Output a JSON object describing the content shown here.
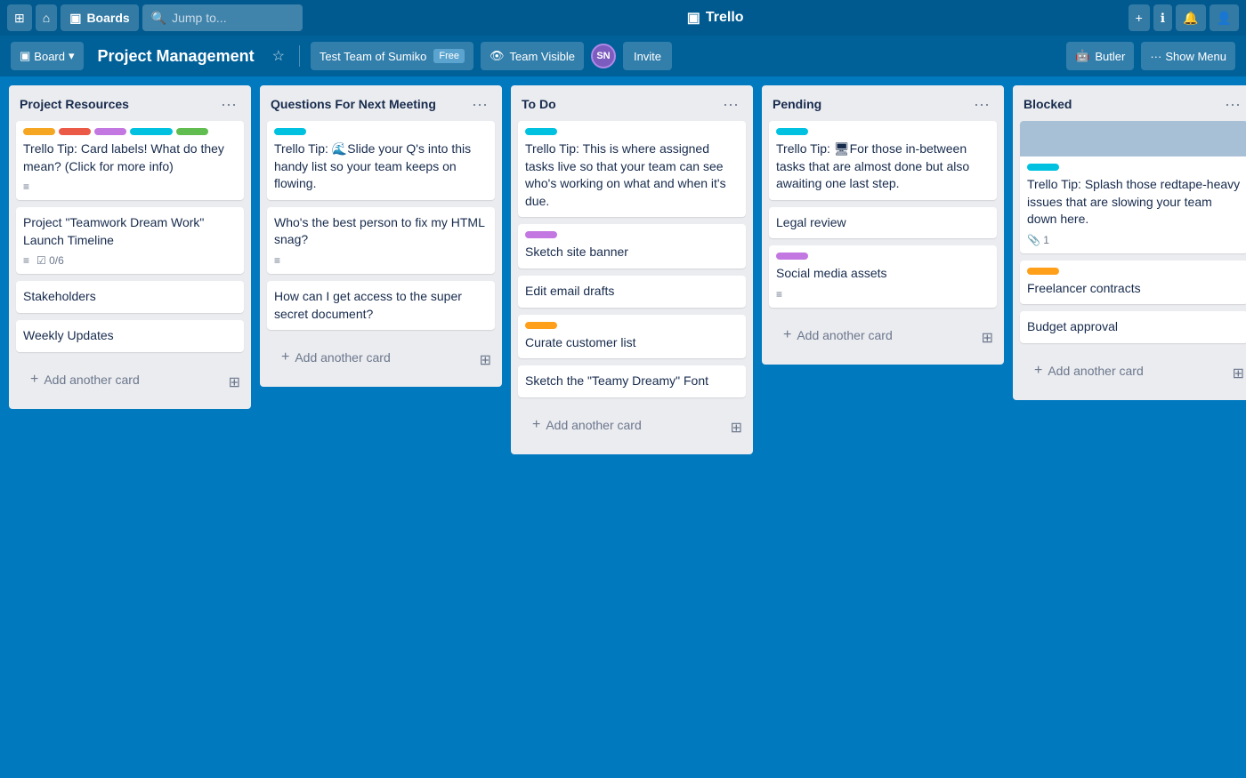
{
  "topnav": {
    "grid_icon": "⊞",
    "home_icon": "⌂",
    "boards_label": "Boards",
    "search_placeholder": "Jump to...",
    "search_icon": "🔍",
    "app_title": "Trello",
    "trello_icon": "▣",
    "add_icon": "+",
    "info_icon": "ℹ",
    "bell_icon": "🔔",
    "profile_icon": "👤"
  },
  "boardheader": {
    "board_icon": "▣",
    "board_label": "Board",
    "board_name": "Project Management",
    "star_icon": "☆",
    "team_name": "Test Team of Sumiko",
    "team_badge": "Free",
    "team_visible_icon": "👁",
    "team_visible_label": "Team Visible",
    "avatar_text": "SN",
    "invite_label": "Invite",
    "butler_icon": "🤖",
    "butler_label": "Butler",
    "show_menu_dots": "···",
    "show_menu_label": "Show Menu"
  },
  "lists": [
    {
      "id": "project-resources",
      "title": "Project Resources",
      "cards": [
        {
          "id": "card-tip-1",
          "labels": [
            "yellow",
            "red",
            "purple",
            "teal",
            "green"
          ],
          "text": "Trello Tip: Card labels! What do they mean? (Click for more info)",
          "has_description": true
        },
        {
          "id": "card-teamwork",
          "labels": [],
          "text": "Project \"Teamwork Dream Work\" Launch Timeline",
          "has_description": true,
          "checklist": "0/6"
        },
        {
          "id": "card-stakeholders",
          "labels": [],
          "text": "Stakeholders"
        },
        {
          "id": "card-weekly",
          "labels": [],
          "text": "Weekly Updates"
        }
      ],
      "add_label": "Add another card"
    },
    {
      "id": "questions-next-meeting",
      "title": "Questions For Next Meeting",
      "cards": [
        {
          "id": "card-tip-2",
          "labels": [
            "cyan"
          ],
          "text": "Trello Tip: 🌊Slide your Q's into this handy list so your team keeps on flowing."
        },
        {
          "id": "card-html",
          "labels": [],
          "text": "Who's the best person to fix my HTML snag?",
          "has_description": true
        },
        {
          "id": "card-secret",
          "labels": [],
          "text": "How can I get access to the super secret document?"
        }
      ],
      "add_label": "Add another card"
    },
    {
      "id": "to-do",
      "title": "To Do",
      "cards": [
        {
          "id": "card-tip-3",
          "labels": [
            "cyan"
          ],
          "text": "Trello Tip: This is where assigned tasks live so that your team can see who's working on what and when it's due."
        },
        {
          "id": "card-sketch-banner",
          "labels": [
            "purple"
          ],
          "text": "Sketch site banner"
        },
        {
          "id": "card-email-drafts",
          "labels": [],
          "text": "Edit email drafts"
        },
        {
          "id": "card-customer-list",
          "labels": [
            "orange"
          ],
          "text": "Curate customer list"
        },
        {
          "id": "card-sketch-font",
          "labels": [],
          "text": "Sketch the \"Teamy Dreamy\" Font"
        }
      ],
      "add_label": "Add another card"
    },
    {
      "id": "pending",
      "title": "Pending",
      "cards": [
        {
          "id": "card-tip-4",
          "labels": [
            "cyan"
          ],
          "text": "Trello Tip: 🖥For those in-between tasks that are almost done but also awaiting one last step."
        },
        {
          "id": "card-legal",
          "labels": [],
          "text": "Legal review"
        },
        {
          "id": "card-social",
          "labels": [
            "purple"
          ],
          "text": "Social media assets",
          "has_description": true
        }
      ],
      "add_label": "Add another card"
    },
    {
      "id": "blocked",
      "title": "Blocked",
      "cards": [
        {
          "id": "card-cover",
          "has_cover": true,
          "labels": [
            "cyan"
          ],
          "text": "Trello Tip: Splash those redtape-heavy issues that are slowing your team down here.",
          "attachment_count": "1"
        },
        {
          "id": "card-freelancer",
          "labels": [
            "orange"
          ],
          "text": "Freelancer contracts"
        },
        {
          "id": "card-budget",
          "labels": [],
          "text": "Budget approval"
        }
      ],
      "add_label": "Add another card"
    }
  ]
}
